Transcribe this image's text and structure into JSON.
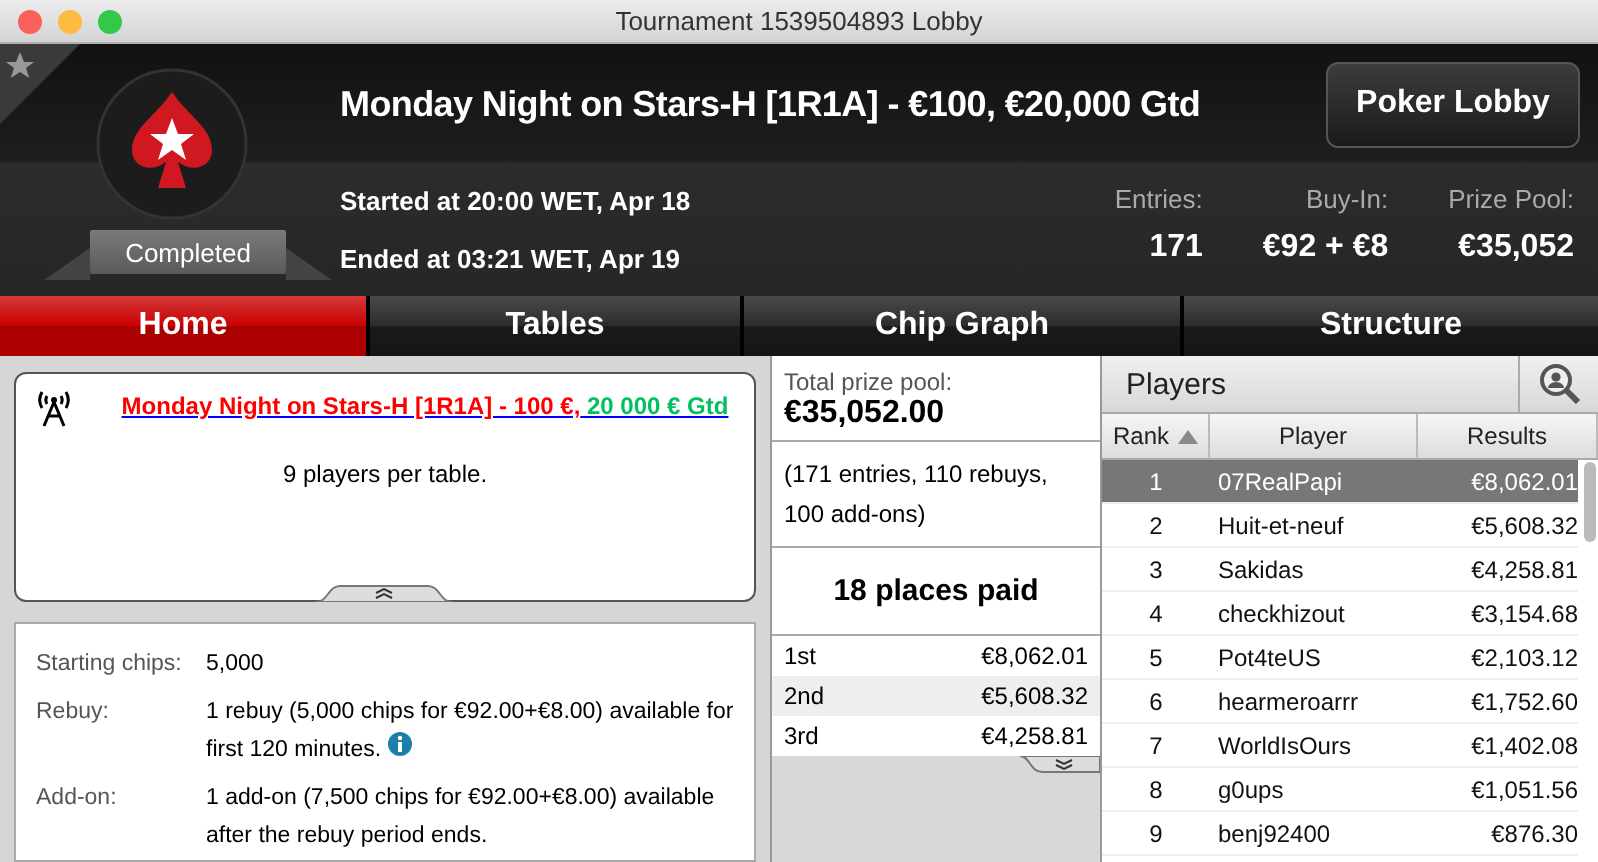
{
  "window": {
    "title": "Tournament 1539504893 Lobby"
  },
  "header": {
    "title": "Monday Night on Stars-H [1R1A] - €100, €20,000 Gtd",
    "status": "Completed",
    "started": "Started at 20:00 WET, Apr 18",
    "ended": "Ended at 03:21 WET, Apr 19",
    "button": "Poker Lobby",
    "stats": [
      {
        "label": "Entries:",
        "value": "171"
      },
      {
        "label": "Buy-In:",
        "value": "€92 + €8"
      },
      {
        "label": "Prize Pool:",
        "value": "€35,052"
      }
    ]
  },
  "tabs": [
    {
      "label": "Home",
      "selected": true
    },
    {
      "label": "Tables",
      "selected": false
    },
    {
      "label": "Chip Graph",
      "selected": false
    },
    {
      "label": "Structure",
      "selected": false
    }
  ],
  "info": {
    "link_parts": [
      {
        "text": "Monday Night on Stars-H [1R1A] - 100 €,",
        "color": "#ff0000"
      },
      {
        "text": "20 000 € Gtd",
        "color": "#00c060"
      }
    ],
    "text": "9 players per table."
  },
  "details": [
    {
      "label": "Starting chips:",
      "value": "5,000",
      "info": false
    },
    {
      "label": "Rebuy:",
      "value": "1 rebuy (5,000 chips for €92.00+€8.00) available for first 120 minutes.",
      "info": true
    },
    {
      "label": "Add-on:",
      "value": "1 add-on (7,500 chips for €92.00+€8.00) available after the rebuy period ends.",
      "info": false
    }
  ],
  "prize": {
    "label": "Total prize pool:",
    "value": "€35,052.00",
    "breakdown": "(171 entries, 110 rebuys, 100 add-ons)",
    "places_paid": "18 places paid",
    "places": [
      {
        "place": "1st",
        "amount": "€8,062.01"
      },
      {
        "place": "2nd",
        "amount": "€5,608.32"
      },
      {
        "place": "3rd",
        "amount": "€4,258.81"
      }
    ]
  },
  "players": {
    "title": "Players",
    "columns": [
      "Rank",
      "Player",
      "Results"
    ],
    "rows": [
      {
        "rank": "1",
        "player": "07RealPapi",
        "result": "€8,062.01",
        "selected": true
      },
      {
        "rank": "2",
        "player": "Huit-et-neuf",
        "result": "€5,608.32",
        "selected": false
      },
      {
        "rank": "3",
        "player": "Sakidas",
        "result": "€4,258.81",
        "selected": false
      },
      {
        "rank": "4",
        "player": "checkhizout",
        "result": "€3,154.68",
        "selected": false
      },
      {
        "rank": "5",
        "player": "Pot4teUS",
        "result": "€2,103.12",
        "selected": false
      },
      {
        "rank": "6",
        "player": "hearmeroarrr",
        "result": "€1,752.60",
        "selected": false
      },
      {
        "rank": "7",
        "player": "WorldIsOurs",
        "result": "€1,402.08",
        "selected": false
      },
      {
        "rank": "8",
        "player": "g0ups",
        "result": "€1,051.56",
        "selected": false
      },
      {
        "rank": "9",
        "player": "benj92400",
        "result": "€876.30",
        "selected": false
      }
    ]
  }
}
